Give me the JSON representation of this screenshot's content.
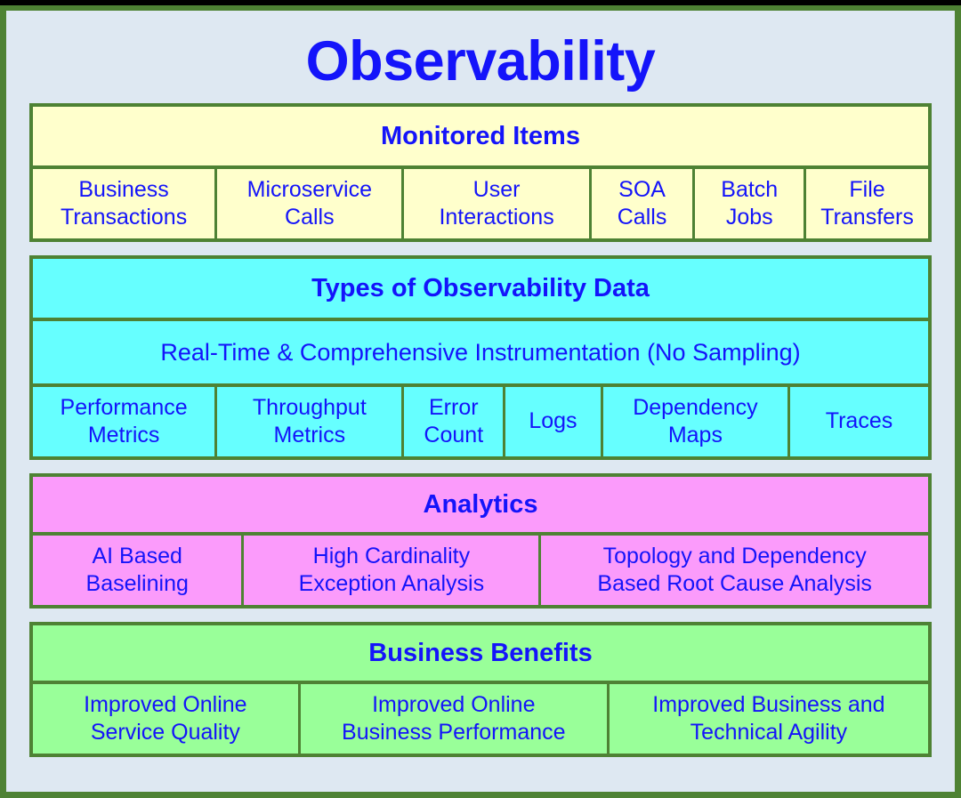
{
  "slide": {
    "title": "Observability",
    "title_color": "#1414FA",
    "background_color": "#DEE8F2",
    "border_color": "#4E8234"
  },
  "sections": {
    "monitored_items": {
      "header": "Monitored Items",
      "fill_color": "#FFFFCC",
      "items": [
        "Business\nTransactions",
        "Microservice\nCalls",
        "User\nInteractions",
        "SOA\nCalls",
        "Batch\nJobs",
        "File\nTransfers"
      ]
    },
    "types_of_observability_data": {
      "header": "Types of Observability Data",
      "fill_color": "#66FFFF",
      "band": "Real-Time & Comprehensive Instrumentation (No Sampling)",
      "items": [
        "Performance\nMetrics",
        "Throughput\nMetrics",
        "Error\nCount",
        "Logs",
        "Dependency\nMaps",
        "Traces"
      ]
    },
    "analytics": {
      "header": "Analytics",
      "fill_color": "#FB9BFB",
      "items": [
        "AI Based\nBaselining",
        "High Cardinality\nException Analysis",
        "Topology and Dependency\nBased Root Cause Analysis"
      ]
    },
    "business_benefits": {
      "header": "Business Benefits",
      "fill_color": "#99FF99",
      "items": [
        "Improved Online\nService Quality",
        "Improved Online\nBusiness Performance",
        "Improved Business and\nTechnical Agility"
      ]
    }
  }
}
